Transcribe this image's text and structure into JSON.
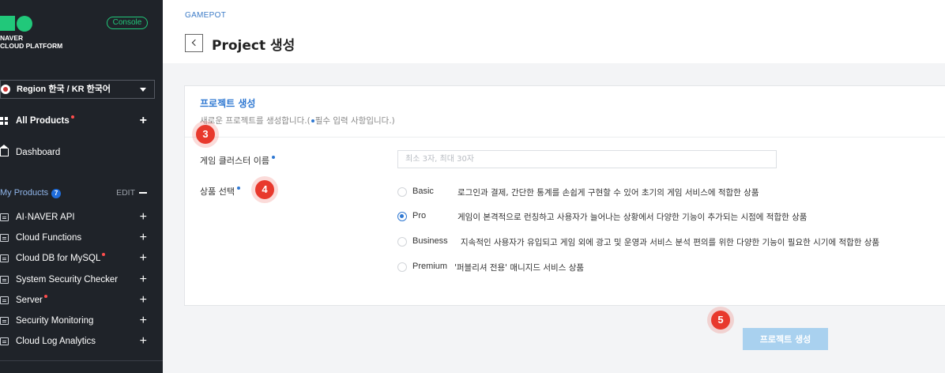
{
  "sidebar": {
    "logo_line1": "NAVER",
    "logo_line2": "CLOUD PLATFORM",
    "console_label": "Console",
    "region_label": "Region 한국 / KR 한국어",
    "all_products_label": "All Products",
    "dashboard_label": "Dashboard",
    "my_products_label": "My Products",
    "my_products_count": "7",
    "edit_label": "EDIT",
    "products": [
      {
        "label": "AI·NAVER API",
        "required": false
      },
      {
        "label": "Cloud Functions",
        "required": false
      },
      {
        "label": "Cloud DB for MySQL",
        "required": true
      },
      {
        "label": "System Security Checker",
        "required": false
      },
      {
        "label": "Server",
        "required": true
      },
      {
        "label": "Security Monitoring",
        "required": false
      },
      {
        "label": "Cloud Log Analytics",
        "required": false
      }
    ]
  },
  "header": {
    "breadcrumb": "GAMEPOT",
    "title": "Project 생성"
  },
  "form": {
    "section_title": "프로젝트 생성",
    "description_before": "새로운 프로젝트를 생성합니다.(",
    "description_after": "필수 입력 사항입니다.)",
    "cluster_name_label": "게임 클러스터 이름",
    "cluster_name_placeholder": "최소 3자, 최대 30자",
    "product_select_label": "상품 선택",
    "options": [
      {
        "name": "Basic",
        "desc": "로그인과 결제, 간단한 통계를 손쉽게 구현할 수 있어 초기의 게임 서비스에 적합한 상품",
        "selected": false
      },
      {
        "name": "Pro",
        "desc": "게임이 본격적으로 런칭하고 사용자가 늘어나는 상황에서 다양한 기능이 추가되는 시점에 적합한 상품",
        "selected": true
      },
      {
        "name": "Business",
        "desc": "지속적인 사용자가 유입되고 게임 외에 광고 및 운영과 서비스 분석 편의를 위한 다양한 기능이 필요한 시기에 적합한 상품",
        "selected": false
      },
      {
        "name": "Premium",
        "desc": "'퍼블리셔 전용' 매니지드 서비스 상품",
        "selected": false
      }
    ],
    "submit_label": "프로젝트 생성"
  },
  "steps": [
    "3",
    "4",
    "5"
  ],
  "colors": {
    "accent": "#2f78d2",
    "brand_green": "#21c87a",
    "step_marker": "#e8392d",
    "sidebar_bg": "#1f2329",
    "submit_disabled": "#a9d1ef"
  }
}
